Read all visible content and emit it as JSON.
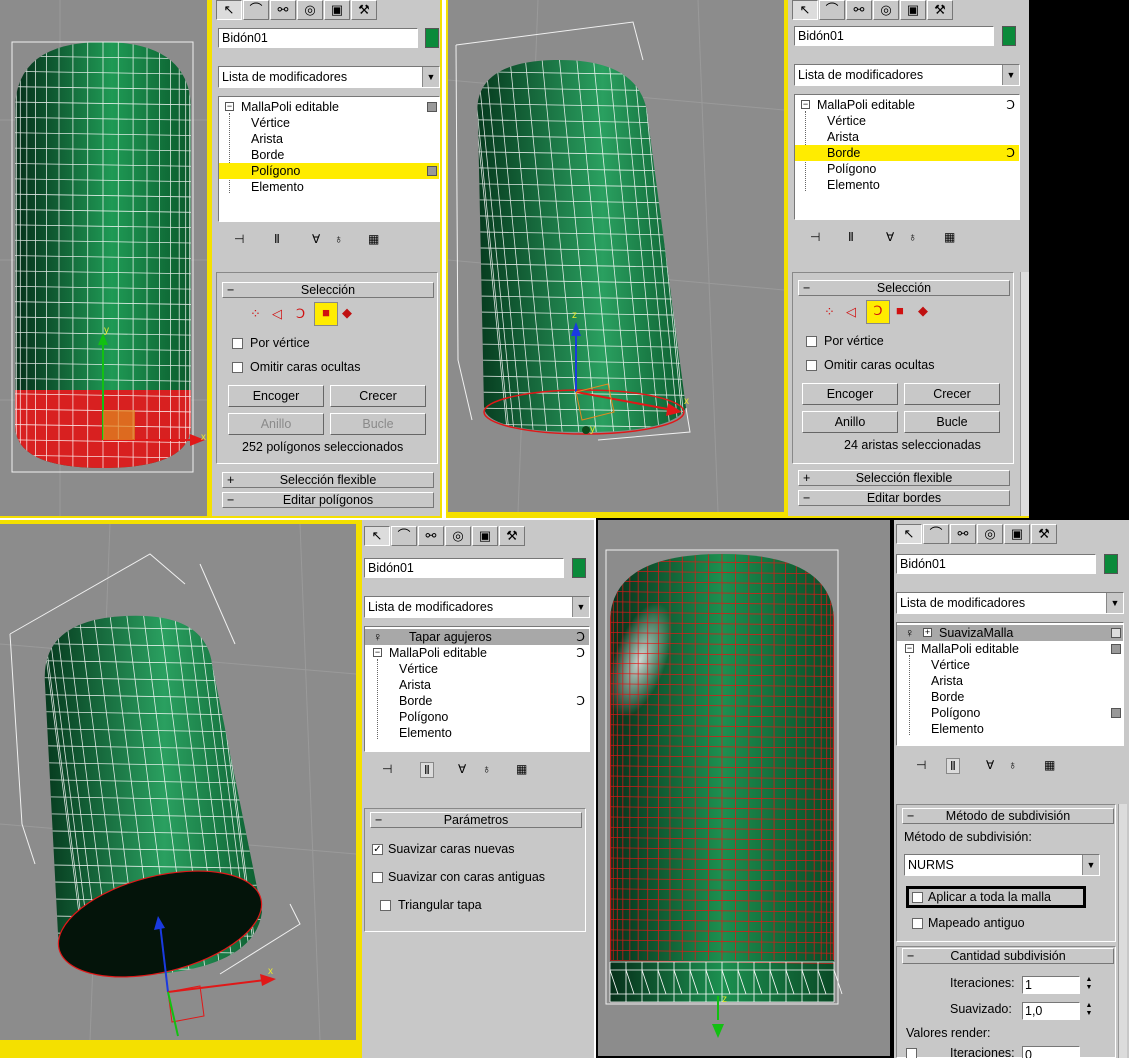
{
  "toolbar_icons": [
    "cursor-icon",
    "bend-icon",
    "hierarchy-icon",
    "motion-icon",
    "display-icon",
    "utilities-hammer-icon"
  ],
  "quad1": {
    "object_name": "Bidón01",
    "modifier_list": "Lista de modificadores",
    "stack": [
      "MallaPoli editable",
      "Vértice",
      "Arista",
      "Borde",
      "Polígono",
      "Elemento"
    ],
    "selected_index": 4,
    "rollout_selection": "Selección",
    "by_vertex": "Por vértice",
    "ignore_backfacing": "Omitir caras ocultas",
    "shrink": "Encoger",
    "grow": "Crecer",
    "ring": "Anillo",
    "loop": "Bucle",
    "status": "252 polígonos seleccionados",
    "soft_selection": "Selección flexible",
    "edit_rollout": "Editar polígonos",
    "axis_y": "y",
    "axis_x": "x"
  },
  "quad2": {
    "object_name": "Bidón01",
    "modifier_list": "Lista de modificadores",
    "stack": [
      "MallaPoli editable",
      "Vértice",
      "Arista",
      "Borde",
      "Polígono",
      "Elemento"
    ],
    "selected_index": 3,
    "rollout_selection": "Selección",
    "by_vertex": "Por vértice",
    "ignore_backfacing": "Omitir caras ocultas",
    "shrink": "Encoger",
    "grow": "Crecer",
    "ring": "Anillo",
    "loop": "Bucle",
    "status": "24 aristas seleccionadas",
    "soft_selection": "Selección flexible",
    "edit_rollout": "Editar bordes",
    "axis_z": "z",
    "axis_x": "x",
    "axis_y": "y"
  },
  "quad3": {
    "object_name": "Bidón01",
    "modifier_list": "Lista de modificadores",
    "stack_top": "Tapar agujeros",
    "stack": [
      "MallaPoli editable",
      "Vértice",
      "Arista",
      "Borde",
      "Polígono",
      "Elemento"
    ],
    "rollout_params": "Parámetros",
    "smooth_new": "Suavizar caras nuevas",
    "smooth_new_checked": true,
    "smooth_old": "Suavizar con caras antiguas",
    "triangulate": "Triangular tapa",
    "axis_x": "x"
  },
  "quad4": {
    "object_name": "Bidón01",
    "modifier_list": "Lista de modificadores",
    "stack_top": "SuavizaMalla",
    "stack": [
      "MallaPoli editable",
      "Vértice",
      "Arista",
      "Borde",
      "Polígono",
      "Elemento"
    ],
    "rollout_method": "Método de subdivisión",
    "method_label": "Método de subdivisión:",
    "method_value": "NURMS",
    "apply_whole": "Aplicar a toda la malla",
    "old_mapping": "Mapeado antiguo",
    "rollout_amount": "Cantidad subdivisión",
    "iterations_label": "Iteraciones:",
    "iterations_value": "1",
    "smoothness_label": "Suavizado:",
    "smoothness_value": "1,0",
    "render_values": "Valores render:",
    "render_iterations_label": "Iteraciones:",
    "render_iterations_value": "0",
    "axis_z": "z"
  },
  "colors": {
    "viewport_border": "#f4e000",
    "mesh_green": "#0f7a3a",
    "selection_red": "#e01818",
    "panel_gray": "#c8c8c8",
    "highlight_yellow": "#ffec00"
  }
}
